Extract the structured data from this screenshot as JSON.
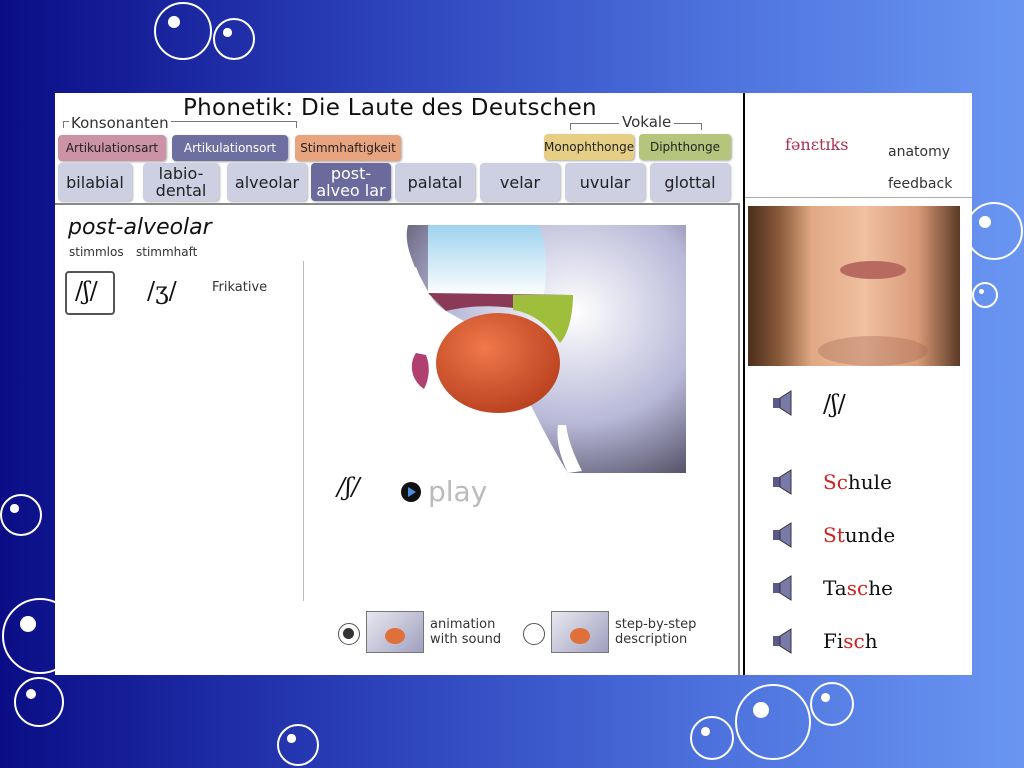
{
  "app_title": "Phonetik:  Die Laute des Deutschen",
  "groups": {
    "consonants": "Konsonanten",
    "vowels": "Vokale"
  },
  "consonant_buttons": [
    {
      "label": "Artikulationsart",
      "color": "#cc93a6"
    },
    {
      "label": "Artikulationsort",
      "color": "#6e6fa1"
    },
    {
      "label": "Stimmhaftigkeit",
      "color": "#e8a37f"
    }
  ],
  "vowel_buttons": [
    {
      "label": "Monophthonge",
      "color": "#e6cf84"
    },
    {
      "label": "Diphthonge",
      "color": "#b5c57c"
    }
  ],
  "places": [
    {
      "label": "bilabial"
    },
    {
      "label": "labio-\ndental"
    },
    {
      "label": "alveolar"
    },
    {
      "label": "post-\nalveolar",
      "active": true
    },
    {
      "label": "palatal"
    },
    {
      "label": "velar"
    },
    {
      "label": "uvular"
    },
    {
      "label": "glottal"
    }
  ],
  "content": {
    "heading": "post-alveolar",
    "voiceless": "stimmlos",
    "voiced": "stimmhaft",
    "symbols": [
      "/ʃ/",
      "/ʒ/"
    ],
    "manner": "Frikative",
    "current_symbol": "/ʃ/",
    "play_label": "play",
    "modes": [
      {
        "label_1": "animation",
        "label_2": "with sound",
        "selected": true
      },
      {
        "label_1": "step-by-step",
        "label_2": "description",
        "selected": false
      }
    ]
  },
  "right": {
    "logo": "fənɛtɪks",
    "links": [
      "anatomy",
      "feedback"
    ],
    "sound_symbol": "/ʃ/",
    "words": [
      {
        "pre": "",
        "hl": "Sc",
        "post": "hule"
      },
      {
        "pre": "",
        "hl": "St",
        "post": "unde"
      },
      {
        "pre": "Ta",
        "hl": "sc",
        "post": "he"
      },
      {
        "pre": "Fi",
        "hl": "sc",
        "post": "h"
      }
    ]
  }
}
